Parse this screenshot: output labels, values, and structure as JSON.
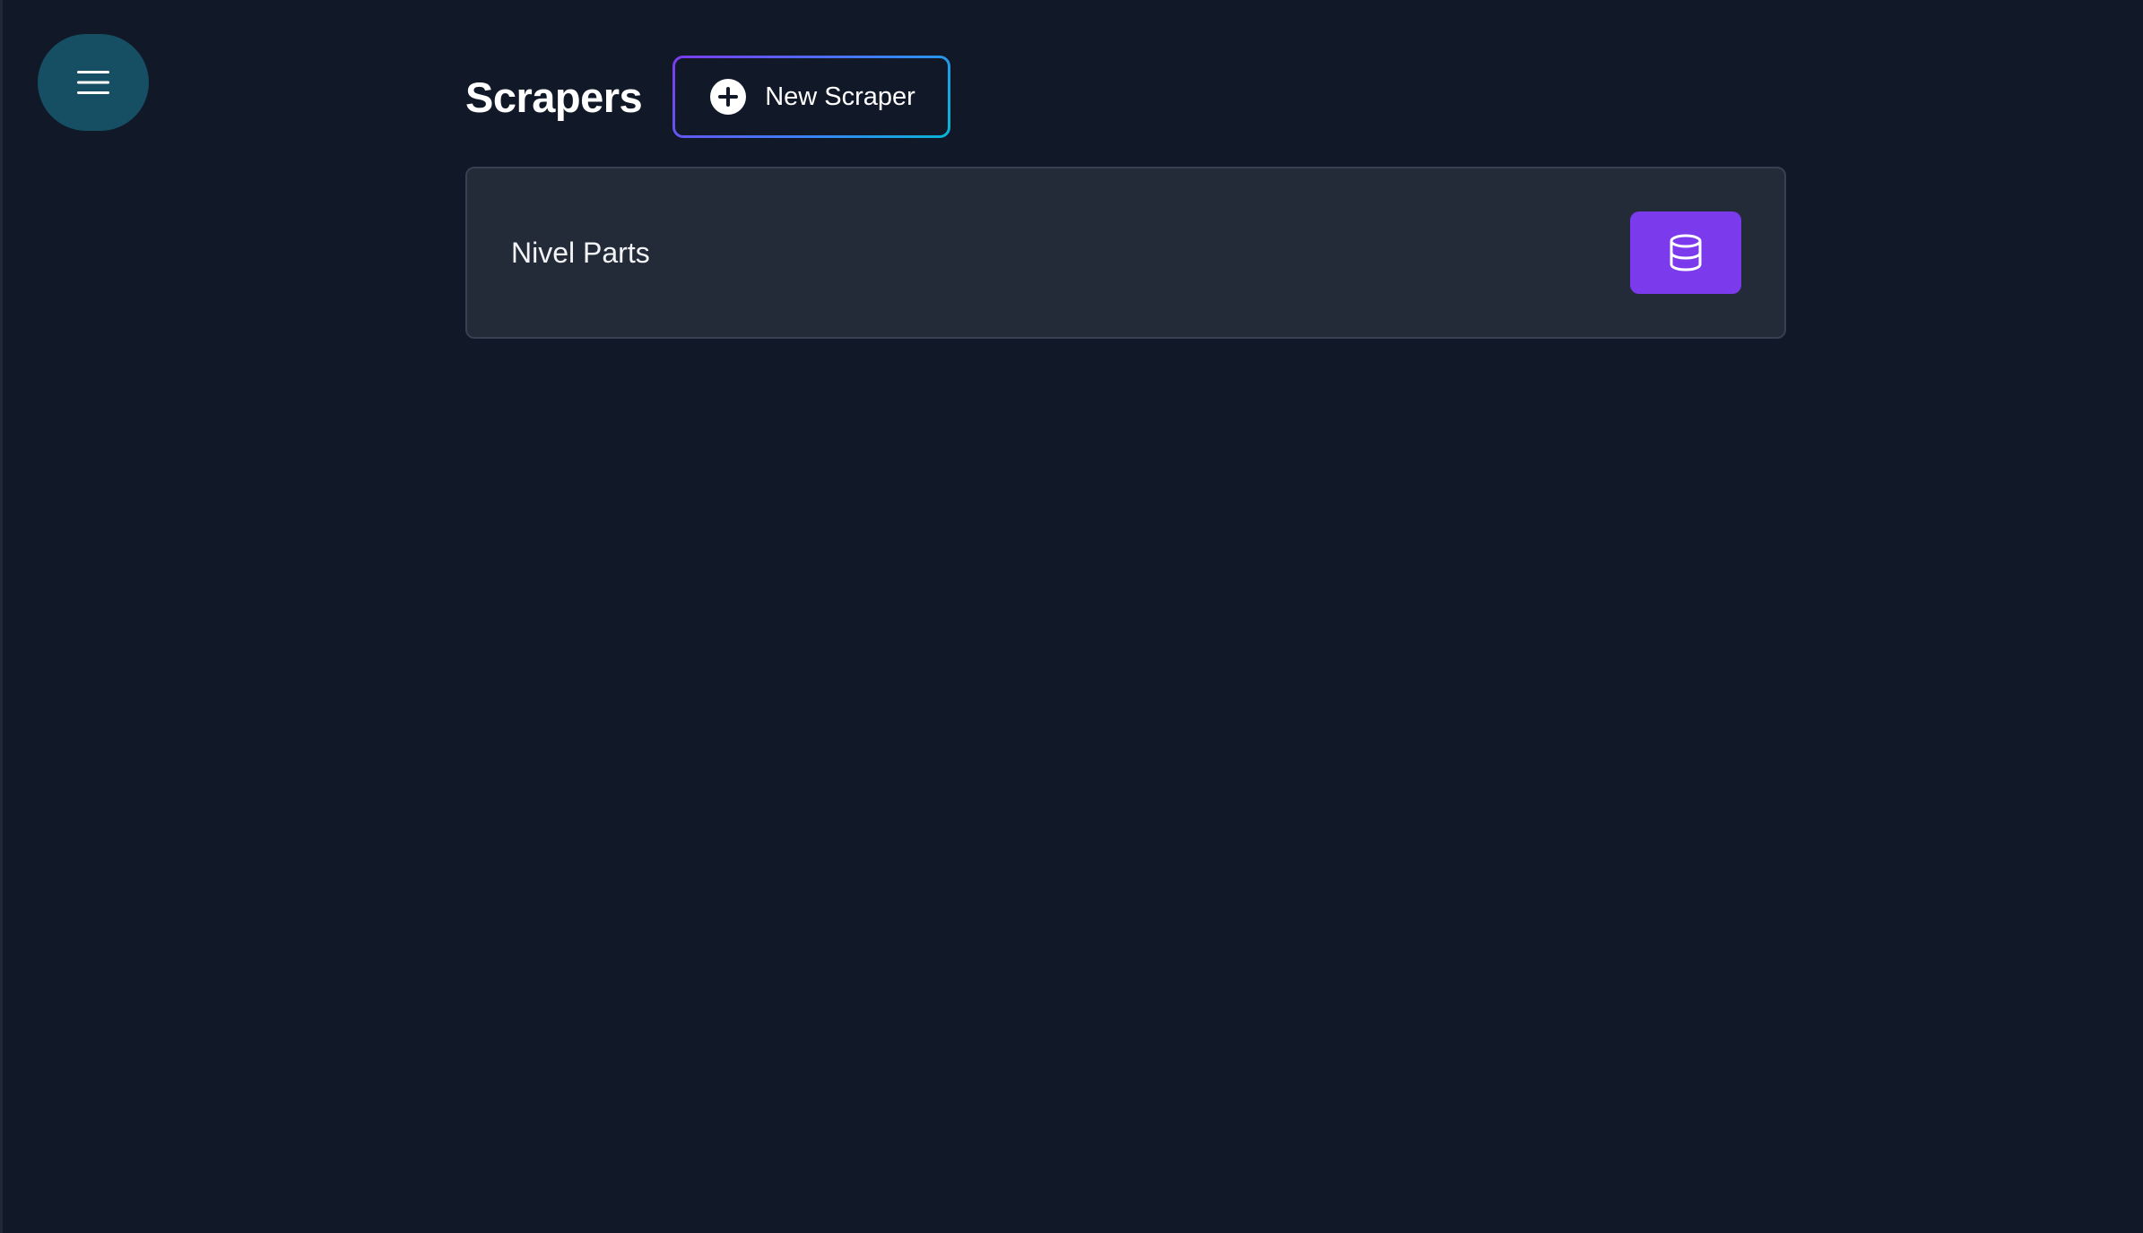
{
  "page": {
    "title": "Scrapers"
  },
  "nav": {
    "menu_icon": "hamburger-menu-icon"
  },
  "toolbar": {
    "new_scraper_label": "New Scraper",
    "new_scraper_icon": "plus-circle-icon"
  },
  "scrapers": [
    {
      "name": "Nivel Parts",
      "action_icon": "database-icon"
    }
  ],
  "colors": {
    "background": "#111827",
    "menu_button": "#164e63",
    "card_background": "#232a38",
    "card_border": "#374151",
    "accent_purple": "#7c3aed",
    "gradient_end_cyan": "#06b6d4"
  }
}
